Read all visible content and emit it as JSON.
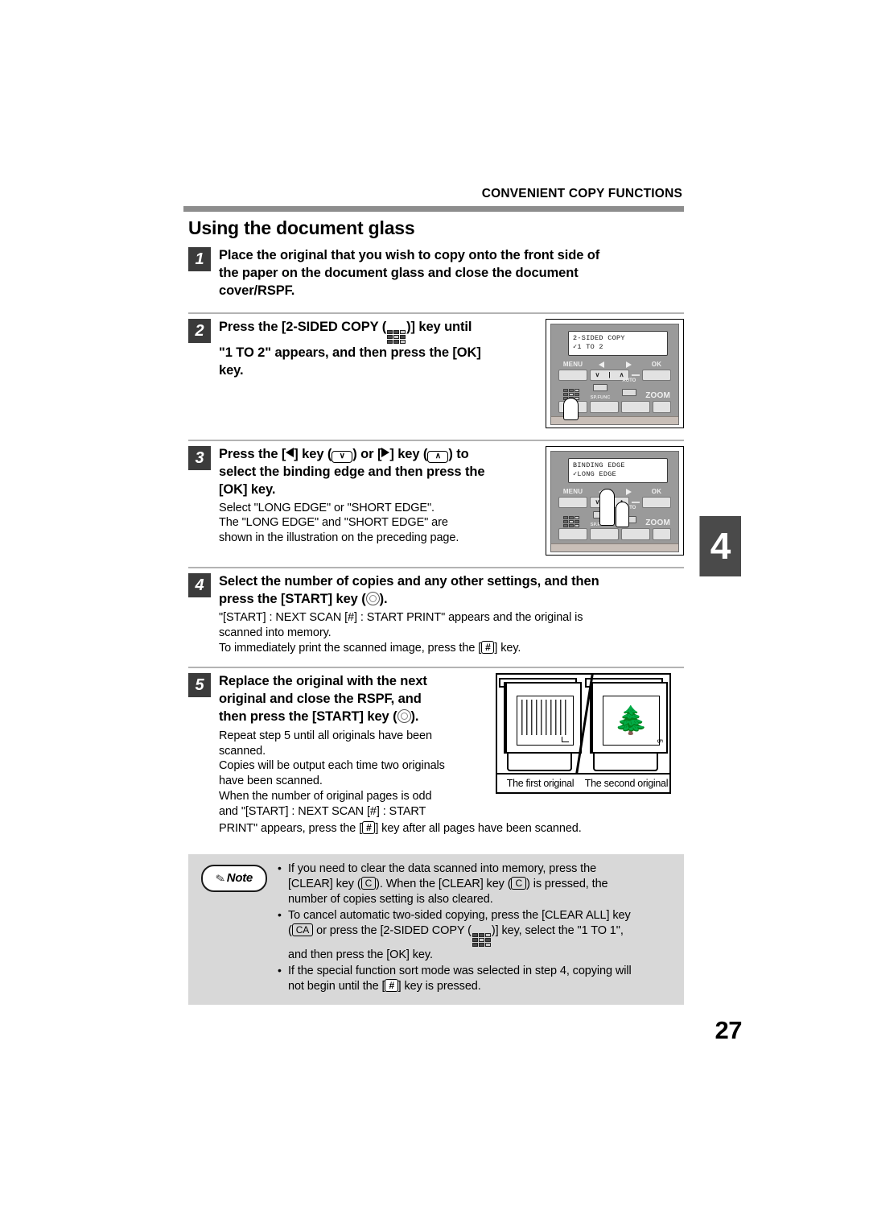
{
  "header": {
    "running_head": "CONVENIENT COPY FUNCTIONS",
    "section_title": "Using the document glass"
  },
  "chapter_tab": "4",
  "page_number": "27",
  "steps": [
    {
      "number": "1",
      "heading_line1": "Place the original that you wish to copy onto the front side of",
      "heading_line2": "the paper on the document glass and close the document",
      "heading_line3": "cover/RSPF."
    },
    {
      "number": "2",
      "heading_a": "Press the [2-SIDED COPY (",
      "heading_b": ")] key until",
      "heading_line2": "\"1 TO 2\" appears, and then press the [OK]",
      "heading_line3": "key."
    },
    {
      "number": "3",
      "heading_a": "Press the [",
      "heading_b": "] key (",
      "heading_c": ") or [",
      "heading_d": "] key (",
      "heading_e": ") to",
      "heading_line2": "select the binding edge and then press the",
      "heading_line3": "[OK] key.",
      "sub_line1": "Select \"LONG EDGE\" or \"SHORT EDGE\".",
      "sub_line2": "The \"LONG EDGE\" and \"SHORT EDGE\" are",
      "sub_line3": "shown in the illustration on the preceding page."
    },
    {
      "number": "4",
      "heading_line1": "Select the number of copies and any other settings, and then",
      "heading_a": "press the [START] key (",
      "heading_b": ").",
      "sub_line1": "\"[START] : NEXT SCAN  [#] : START PRINT\" appears and the original is",
      "sub_line2": "scanned into memory.",
      "sub_line3_a": "To immediately print the scanned image, press the [",
      "sub_line3_b": "] key."
    },
    {
      "number": "5",
      "heading_line1": "Replace the original with the next",
      "heading_line2": "original and close the RSPF, and",
      "heading_a": "then press the [START] key (",
      "heading_b": ").",
      "sub_line1": "Repeat step 5 until all originals have been",
      "sub_line2": "scanned.",
      "sub_line3": "Copies will be output each time two originals",
      "sub_line4": "have been scanned.",
      "sub_line5": "When the number of original pages is odd",
      "sub_line6": "and \"[START] : NEXT SCAN  [#] : START",
      "sub_line7_a": "PRINT\" appears, press the [",
      "sub_line7_b": "] key after all pages have been scanned."
    }
  ],
  "panel_step2": {
    "lcd_line1": "2-SIDED COPY",
    "lcd_line2": "✓1 TO 2",
    "label_menu": "MENU",
    "label_ok": "OK",
    "label_zoom": "ZOOM",
    "label_spfunc": "SP.FUNC",
    "label_auto": "AUTO",
    "nav_down": "∨",
    "nav_divider": "|",
    "nav_up": "∧"
  },
  "panel_step3": {
    "lcd_line1": "BINDING EDGE",
    "lcd_line2": "✓LONG EDGE",
    "label_menu": "MENU",
    "label_ok": "OK",
    "label_zoom": "ZOOM",
    "label_spfunc": "SP.FUNC",
    "label_auto": "AUTO",
    "nav_down": "∨",
    "nav_divider": "|",
    "nav_up": "∧"
  },
  "originals_figure": {
    "caption_first": "The first original",
    "caption_second": "The second original",
    "second_page_mark": "5"
  },
  "note": {
    "badge_label": "Note",
    "badge_icon": "pencil-icon",
    "items": [
      {
        "a": "If you need to clear the data scanned into memory, press the",
        "b": "[CLEAR] key (",
        "key1": "C",
        "c": "). When the [CLEAR] key (",
        "key2": "C",
        "d": ") is pressed, the",
        "e": "number of copies setting is also cleared."
      },
      {
        "a": "To cancel automatic two-sided copying, press the [CLEAR ALL] key",
        "b": "(",
        "key1": "CA",
        "c": " or press the [2-SIDED COPY (",
        "d": ")] key, select the \"1 TO 1\",",
        "e": "and then press the [OK] key."
      },
      {
        "a": "If the special function sort mode was selected in step 4, copying will",
        "b": "not begin until the [",
        "key1": "#",
        "c": "] key is pressed."
      }
    ]
  },
  "colors": {
    "rule_gray": "#8d8d8d",
    "step_num_bg": "#3b3b3b",
    "note_bg": "#d8d8d8",
    "tab_bg": "#4a4a4a",
    "panel_body": "#9a9a9a"
  }
}
